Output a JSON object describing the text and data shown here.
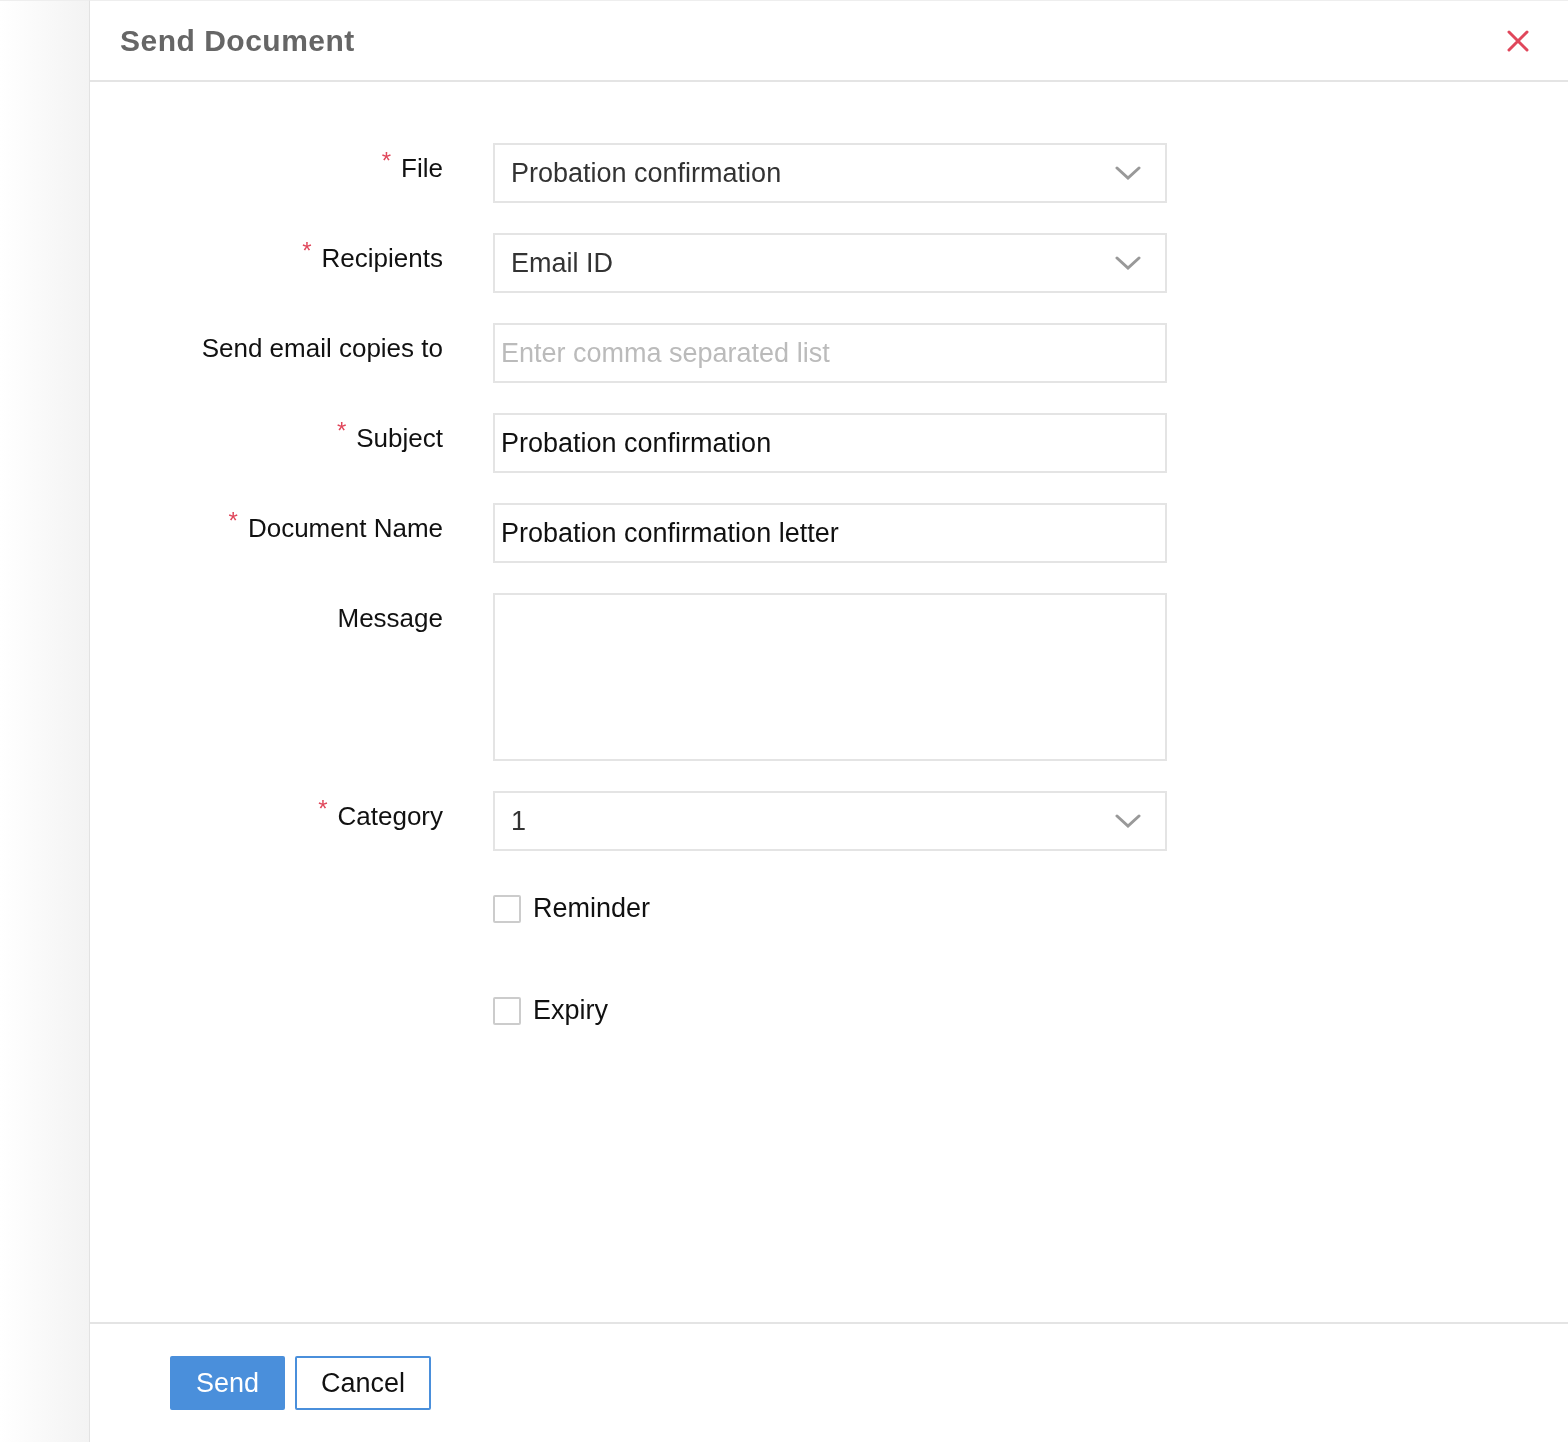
{
  "dialog": {
    "title": "Send Document"
  },
  "fields": [
    {
      "kind": "select",
      "required_mark": "*",
      "label": "File",
      "value": "Probation confirmation"
    },
    {
      "kind": "select",
      "required_mark": "*",
      "label": "Recipients",
      "value": "Email ID"
    },
    {
      "kind": "input",
      "label": "Send email copies to",
      "placeholder": "Enter comma separated list"
    },
    {
      "kind": "input",
      "required_mark": "*",
      "label": "Subject",
      "value": "Probation confirmation"
    },
    {
      "kind": "input",
      "required_mark": "*",
      "label": "Document Name",
      "value": "Probation confirmation letter"
    },
    {
      "kind": "textarea",
      "label": "Message"
    },
    {
      "kind": "select",
      "required_mark": "*",
      "label": "Category",
      "value": "1"
    }
  ],
  "options": [
    {
      "label": "Reminder",
      "checked": false
    },
    {
      "label": "Expiry",
      "checked": false
    }
  ],
  "buttons": [
    {
      "label": "Send",
      "kind": "primary"
    },
    {
      "label": "Cancel",
      "kind": "secondary"
    }
  ]
}
